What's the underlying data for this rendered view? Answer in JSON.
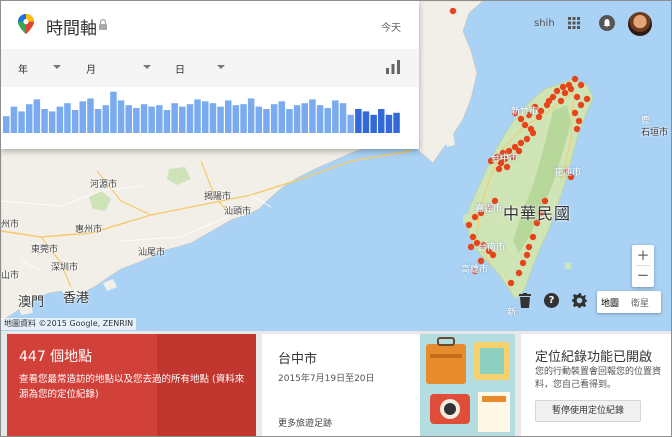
{
  "header": {
    "app_title": "時間軸",
    "today_label": "今天",
    "user_name": "shih"
  },
  "timeline": {
    "year_label": "年",
    "month_label": "月",
    "day_label": "日",
    "histogram_levels": [
      0.35,
      0.55,
      0.45,
      0.6,
      0.7,
      0.5,
      0.45,
      0.55,
      0.62,
      0.48,
      0.66,
      0.72,
      0.5,
      0.58,
      0.86,
      0.68,
      0.58,
      0.52,
      0.6,
      0.55,
      0.58,
      0.48,
      0.62,
      0.55,
      0.6,
      0.7,
      0.66,
      0.62,
      0.55,
      0.68,
      0.58,
      0.6,
      0.72,
      0.55,
      0.5,
      0.6,
      0.66,
      0.5,
      0.58,
      0.62,
      0.7,
      0.58,
      0.52,
      0.68,
      0.62,
      0.38,
      0.5,
      0.45,
      0.38,
      0.5,
      0.38,
      0.42
    ],
    "histogram_colors": {
      "normal": "#7aaaf0",
      "recent": "#3369d6",
      "gap": "#ffffff"
    }
  },
  "map": {
    "places": [
      {
        "name": "河源市",
        "cls": ""
      },
      {
        "name": "揭陽市",
        "cls": ""
      },
      {
        "name": "汕頭市",
        "cls": ""
      },
      {
        "name": "惠州市",
        "cls": ""
      },
      {
        "name": "汕尾市",
        "cls": ""
      },
      {
        "name": "東莞市",
        "cls": ""
      },
      {
        "name": "深圳市",
        "cls": ""
      },
      {
        "name": "香港",
        "cls": "big"
      },
      {
        "name": "澳門",
        "cls": "big"
      },
      {
        "name": "州市",
        "cls": ""
      },
      {
        "name": "山市",
        "cls": ""
      },
      {
        "name": "新竹市",
        "cls": "white"
      },
      {
        "name": "台中市",
        "cls": "white"
      },
      {
        "name": "花蓮市",
        "cls": "white"
      },
      {
        "name": "嘉義市",
        "cls": "white"
      },
      {
        "name": "中華民國",
        "cls": "country"
      },
      {
        "name": "台南市",
        "cls": "white"
      },
      {
        "name": "高雄市",
        "cls": "white"
      },
      {
        "name": "新",
        "cls": "white"
      },
      {
        "name": "鹿",
        "cls": "white"
      },
      {
        "name": "石垣市",
        "cls": "dark"
      }
    ],
    "pin_color": "#e8441b",
    "attribution": "地圖資料 ©2015 Google, ZENRIN",
    "map_type_map": "地圖",
    "map_type_satellite": "衛星"
  },
  "cards": {
    "places_count": "447 個地點",
    "places_desc": "查看您最常造訪的地點以及您去過的所有地點 (資料來源為您的定位紀錄)",
    "city_name": "台中市",
    "city_date": "2015年7月19日至20日",
    "city_more": "更多旅遊足跡",
    "history_title": "定位紀錄功能已開啟",
    "history_desc": "您的行動裝置會回報您的位置資料，您自己看得到。",
    "pause_button": "暫停使用定位紀錄"
  }
}
